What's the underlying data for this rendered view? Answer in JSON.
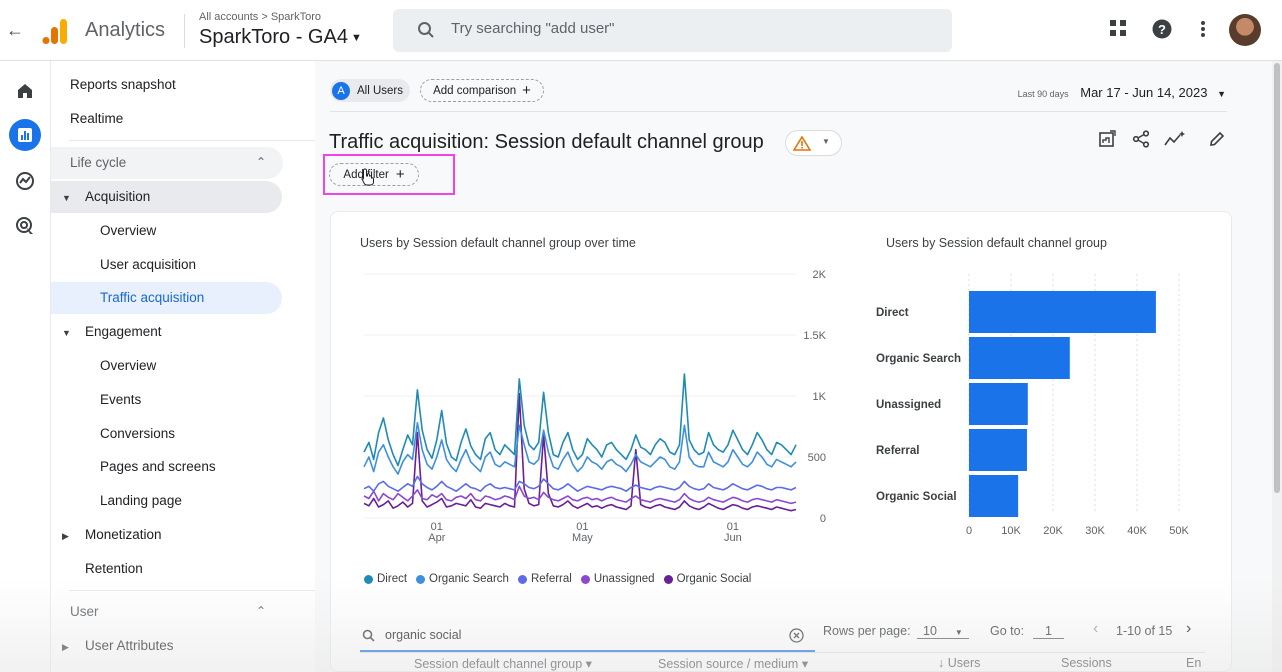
{
  "header": {
    "app_name": "Analytics",
    "breadcrumb": "All accounts > SparkToro",
    "property": "SparkToro - GA4",
    "search_placeholder": "Try searching \"add user\""
  },
  "rail": {
    "items": [
      "home-icon",
      "reports-icon",
      "explore-icon",
      "advertising-icon"
    ]
  },
  "nav": {
    "reports_snapshot": "Reports snapshot",
    "realtime": "Realtime",
    "lifecycle": "Life cycle",
    "acquisition": "Acquisition",
    "acq_overview": "Overview",
    "user_acquisition": "User acquisition",
    "traffic_acquisition": "Traffic acquisition",
    "engagement": "Engagement",
    "eng_overview": "Overview",
    "events": "Events",
    "conversions": "Conversions",
    "pages_and_screens": "Pages and screens",
    "landing_page": "Landing page",
    "monetization": "Monetization",
    "retention": "Retention",
    "user_section": "User",
    "user_attributes": "User Attributes"
  },
  "main": {
    "all_users_badge": "A",
    "all_users": "All Users",
    "add_comparison": "Add comparison",
    "date_label": "Last 90 days",
    "date_range": "Mar 17 - Jun 14, 2023",
    "title": "Traffic acquisition: Session default channel group",
    "add_filter": "Add filter",
    "table_search": "organic social",
    "rows_per_page_label": "Rows per page:",
    "rows_per_page": "10",
    "go_to_label": "Go to:",
    "go_to": "1",
    "range_label": "1-10 of 15",
    "col1": "Session default channel group",
    "col2": "Session source / medium",
    "col3": "Users",
    "col4": "Sessions",
    "col5": "En"
  },
  "colors": {
    "brand_blue": "#1a73e8",
    "highlight": "#f044e8",
    "direct": "#1f8bb5",
    "organic_search": "#3f8fdf",
    "referral": "#5b6bea",
    "unassigned": "#8a48cf",
    "organic_social": "#6a1f95"
  },
  "chart_data": [
    {
      "type": "line",
      "title": "Users by Session default channel group over time",
      "x_ticks": [
        "01\nApr",
        "01\nMay",
        "01\nJun"
      ],
      "y_ticks": [
        "0",
        "500",
        "1K",
        "1.5K",
        "2K"
      ],
      "ylim": [
        0,
        2000
      ],
      "legend_position": "bottom",
      "series": [
        {
          "name": "Direct",
          "values": [
            540,
            620,
            480,
            700,
            820,
            640,
            520,
            430,
            560,
            680,
            600,
            1050,
            720,
            560,
            490,
            640,
            880,
            610,
            500,
            470,
            620,
            730,
            590,
            520,
            480,
            650,
            700,
            560,
            520,
            600,
            560,
            520,
            1140,
            760,
            600,
            560,
            620,
            1030,
            700,
            520,
            500,
            620,
            700,
            560,
            480,
            520,
            650,
            600,
            560,
            500,
            600,
            620,
            560,
            520,
            480,
            560,
            680,
            580,
            560,
            520,
            600,
            650,
            620,
            540,
            520,
            600,
            1180,
            640,
            560,
            520,
            540,
            700,
            600,
            560,
            540,
            600,
            720,
            640,
            560,
            520,
            600,
            700,
            640,
            560,
            520,
            620,
            600,
            560,
            520,
            600
          ]
        },
        {
          "name": "Organic Search",
          "values": [
            420,
            500,
            380,
            540,
            600,
            500,
            420,
            360,
            460,
            520,
            480,
            780,
            560,
            440,
            400,
            500,
            640,
            480,
            420,
            380,
            480,
            560,
            460,
            420,
            380,
            500,
            540,
            440,
            420,
            460,
            440,
            420,
            760,
            600,
            460,
            440,
            480,
            720,
            540,
            420,
            400,
            480,
            540,
            440,
            380,
            420,
            500,
            460,
            440,
            400,
            460,
            480,
            440,
            420,
            380,
            440,
            520,
            460,
            440,
            420,
            460,
            500,
            480,
            420,
            400,
            460,
            760,
            500,
            440,
            420,
            420,
            540,
            460,
            440,
            420,
            460,
            560,
            500,
            440,
            420,
            460,
            540,
            500,
            440,
            420,
            480,
            460,
            440,
            420,
            460
          ]
        },
        {
          "name": "Referral",
          "values": [
            240,
            260,
            220,
            280,
            300,
            260,
            240,
            220,
            250,
            280,
            260,
            340,
            280,
            250,
            230,
            260,
            300,
            260,
            240,
            220,
            250,
            280,
            250,
            240,
            220,
            260,
            280,
            250,
            240,
            250,
            240,
            230,
            300,
            280,
            250,
            240,
            260,
            320,
            280,
            240,
            230,
            250,
            280,
            250,
            220,
            240,
            260,
            250,
            240,
            230,
            250,
            260,
            250,
            240,
            220,
            250,
            270,
            250,
            240,
            230,
            250,
            260,
            250,
            240,
            230,
            250,
            300,
            260,
            240,
            230,
            240,
            280,
            250,
            240,
            230,
            250,
            280,
            260,
            240,
            230,
            250,
            270,
            260,
            240,
            230,
            250,
            250,
            240,
            230,
            250
          ]
        },
        {
          "name": "Unassigned",
          "values": [
            180,
            160,
            220,
            140,
            200,
            170,
            150,
            200,
            170,
            140,
            180,
            230,
            160,
            150,
            190,
            170,
            200,
            150,
            140,
            170,
            180,
            160,
            200,
            150,
            140,
            180,
            170,
            150,
            160,
            180,
            170,
            150,
            260,
            180,
            160,
            170,
            150,
            210,
            170,
            150,
            140,
            160,
            180,
            150,
            140,
            160,
            170,
            150,
            160,
            140,
            160,
            170,
            150,
            140,
            130,
            160,
            180,
            150,
            140,
            130,
            150,
            160,
            150,
            140,
            130,
            150,
            200,
            160,
            140,
            130,
            140,
            170,
            150,
            140,
            130,
            150,
            170,
            160,
            140,
            130,
            150,
            160,
            150,
            140,
            130,
            150,
            140,
            130,
            120,
            130
          ]
        },
        {
          "name": "Organic Social",
          "values": [
            120,
            100,
            160,
            90,
            110,
            140,
            80,
            100,
            130,
            90,
            120,
            700,
            140,
            90,
            110,
            130,
            160,
            90,
            100,
            120,
            110,
            100,
            150,
            90,
            80,
            120,
            110,
            100,
            90,
            120,
            100,
            90,
            1020,
            240,
            120,
            100,
            110,
            680,
            200,
            100,
            90,
            110,
            140,
            100,
            80,
            100,
            120,
            90,
            100,
            80,
            100,
            110,
            90,
            80,
            70,
            100,
            560,
            110,
            90,
            80,
            100,
            110,
            90,
            80,
            70,
            90,
            140,
            100,
            80,
            70,
            90,
            120,
            100,
            80,
            70,
            90,
            110,
            100,
            80,
            70,
            90,
            100,
            90,
            80,
            70,
            90,
            80,
            70,
            60,
            70
          ]
        }
      ]
    },
    {
      "type": "bar",
      "orientation": "horizontal",
      "title": "Users by Session default channel group",
      "categories": [
        "Direct",
        "Organic Search",
        "Unassigned",
        "Referral",
        "Organic Social"
      ],
      "values": [
        44500,
        24000,
        14000,
        13800,
        11700
      ],
      "x_ticks": [
        "0",
        "10K",
        "20K",
        "30K",
        "40K",
        "50K"
      ],
      "xlim": [
        0,
        50000
      ]
    }
  ]
}
